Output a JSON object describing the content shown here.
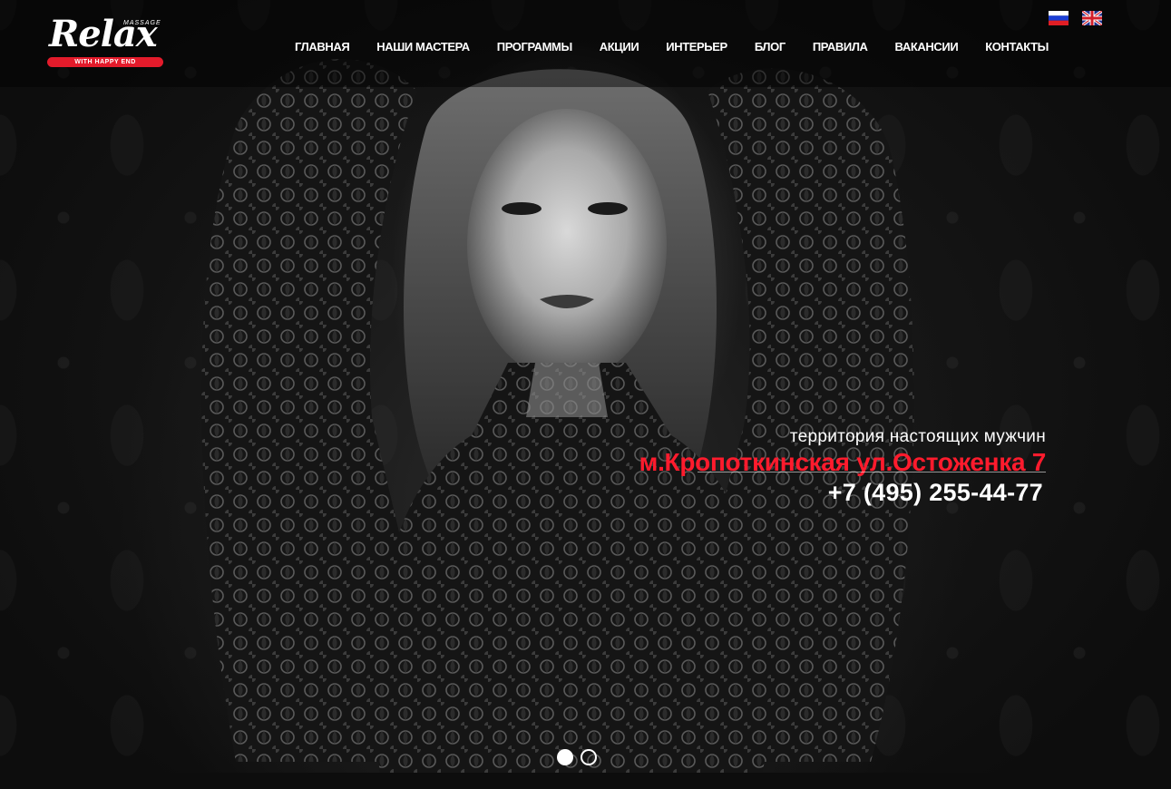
{
  "logo": {
    "script_text": "Relax",
    "top_text": "MASSAGE",
    "band_text": "WITH HAPPY END"
  },
  "nav": {
    "items": [
      {
        "label": "ГЛАВНАЯ"
      },
      {
        "label": "НАШИ МАСТЕРА"
      },
      {
        "label": "ПРОГРАММЫ"
      },
      {
        "label": "АКЦИИ"
      },
      {
        "label": "ИНТЕРЬЕР"
      },
      {
        "label": "БЛОГ"
      },
      {
        "label": "ПРАВИЛА"
      },
      {
        "label": "ВАКАНСИИ"
      },
      {
        "label": "КОНТАКТЫ"
      }
    ]
  },
  "languages": [
    {
      "code": "ru",
      "icon": "russian-flag-icon"
    },
    {
      "code": "en",
      "icon": "uk-flag-icon"
    }
  ],
  "hero": {
    "tagline": "территория настоящих мужчин",
    "address": "м.Кропоткинская ул.Остоженка 7",
    "phone": "+7 (495) 255-44-77"
  },
  "slider": {
    "slide_count": 2,
    "active_index": 0
  },
  "colors": {
    "accent": "#ff1b2d",
    "brand_red": "#e31b2b",
    "text": "#ffffff",
    "background": "#0c0c0c"
  }
}
